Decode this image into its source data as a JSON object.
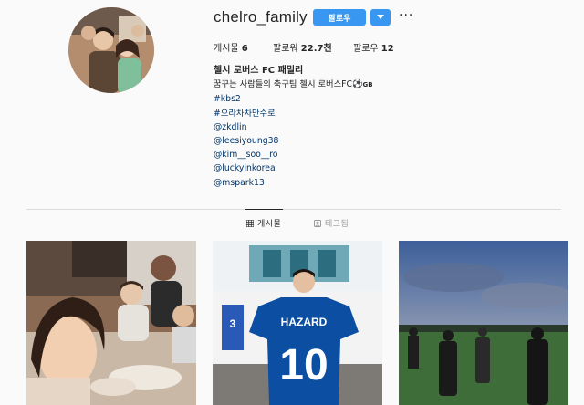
{
  "profile": {
    "username": "chelro_family",
    "follow_label": "팔로우",
    "more_label": "···"
  },
  "stats": {
    "posts_label": "게시물",
    "posts_value": "6",
    "followers_label": "팔로워",
    "followers_value": "22.7천",
    "following_label": "팔로우",
    "following_value": "12"
  },
  "bio": {
    "name": "첼시 로버스 FC 패밀리",
    "line1": "꿈꾸는 사람들의 축구팀 첼시 로버스FC",
    "line1_emoji": "⚽",
    "line1_flag": "GB",
    "hashtags": [
      "#kbs2",
      "#으라차차만수로"
    ],
    "mentions": [
      "@zkdlin",
      "@leesiyoung38",
      "@kim__soo__ro",
      "@luckyinkorea",
      "@mspark13"
    ]
  },
  "tabs": [
    {
      "label": "게시물",
      "icon": "grid-icon",
      "active": true
    },
    {
      "label": "태그됨",
      "icon": "tag-icon",
      "active": false
    }
  ],
  "posts": [
    {
      "icon": "group-selfie-photo"
    },
    {
      "icon": "hazard-jersey-photo",
      "jersey_name": "HAZARD",
      "jersey_number": "10"
    },
    {
      "icon": "sunset-field-photo"
    }
  ],
  "colors": {
    "accent": "#3897f0",
    "link": "#003569",
    "divider": "#dbdbdb",
    "background": "#fafafa"
  }
}
